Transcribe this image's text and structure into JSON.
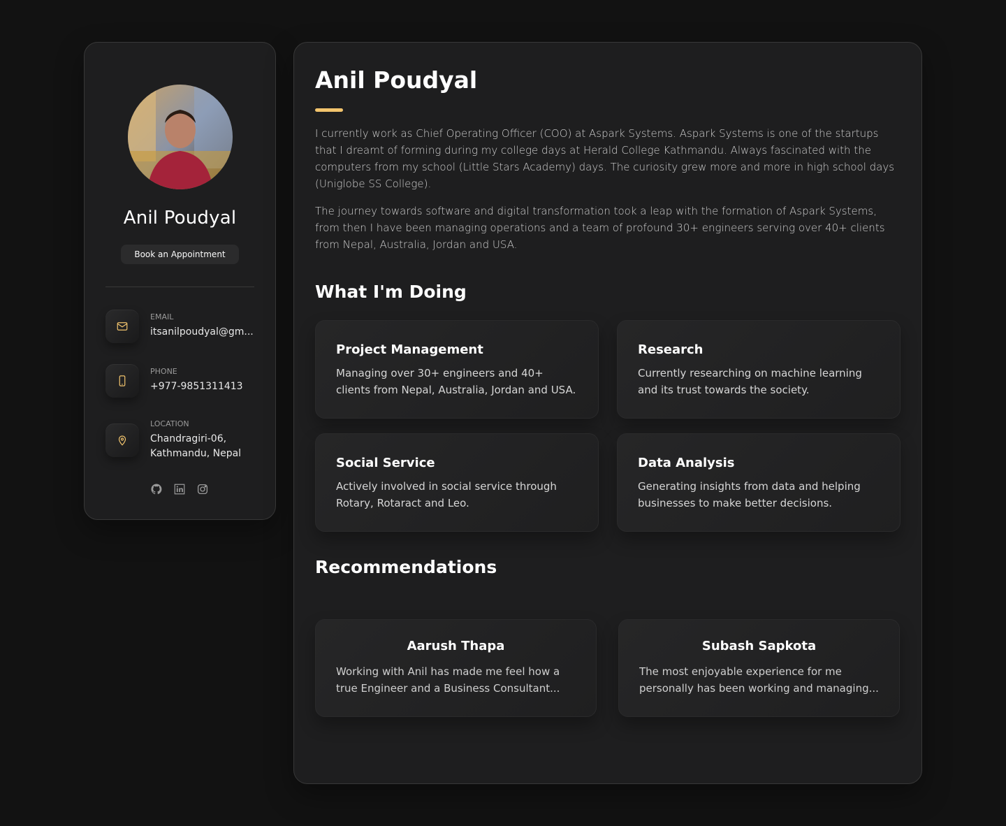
{
  "profile": {
    "name": "Anil Poudyal",
    "appointment_label": "Book an Appointment"
  },
  "contacts": [
    {
      "label": "EMAIL",
      "value": "itsanilpoudyal@gm...",
      "icon": "mail-icon"
    },
    {
      "label": "PHONE",
      "value": "+977-9851311413",
      "icon": "phone-icon"
    },
    {
      "label": "LOCATION",
      "value": "Chandragiri-06, Kathmandu, Nepal",
      "icon": "location-pin-icon"
    }
  ],
  "socials": [
    "github-icon",
    "linkedin-icon",
    "instagram-icon"
  ],
  "main": {
    "title": "Anil Poudyal",
    "about": [
      "I currently work as Chief Operating Officer (COO) at Aspark Systems. Aspark Systems is one of the startups that I dreamt of forming during my college days at Herald College Kathmandu. Always fascinated with the computers from my school (Little Stars Academy) days. The curiosity grew more and more in high school days (Uniglobe SS College).",
      "The journey towards software and digital transformation took a leap with the formation of Aspark Systems, from then I have been managing operations and a team of profound 30+ engineers serving over 40+ clients from Nepal, Australia, Jordan and USA."
    ],
    "services_title": "What I'm Doing",
    "services": [
      {
        "title": "Project Management",
        "desc": "Managing over 30+ engineers and 40+ clients from Nepal, Australia, Jordan and USA."
      },
      {
        "title": "Research",
        "desc": "Currently researching on machine learning and its trust towards the society."
      },
      {
        "title": "Social Service",
        "desc": "Actively involved in social service through Rotary, Rotaract and Leo."
      },
      {
        "title": "Data Analysis",
        "desc": "Generating insights from data and helping businesses to make better decisions."
      }
    ],
    "recommendations_title": "Recommendations",
    "recommendations": [
      {
        "name": "Aarush Thapa",
        "text": "Working with Anil has made me feel how a true Engineer and a Business Consultant..."
      },
      {
        "name": "Subash Sapkota",
        "text": "The most enjoyable experience for me personally has been working and managing..."
      }
    ]
  },
  "colors": {
    "accent": "#f2c46d",
    "background": "#121212",
    "card": "#1e1e1f"
  }
}
